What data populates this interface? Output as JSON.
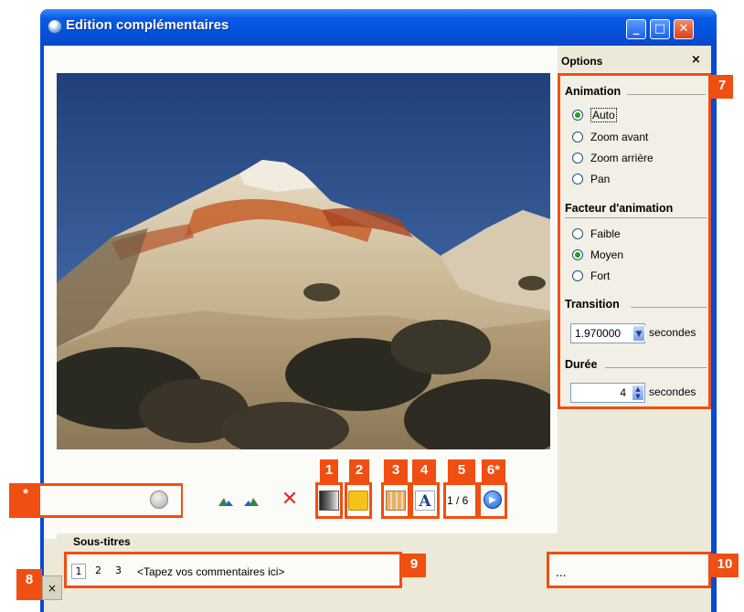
{
  "window": {
    "title": "Edition complémentaires",
    "controls": {
      "minimize": "_",
      "maximize": "□",
      "close": "✕"
    }
  },
  "options": {
    "header": "Options",
    "close_glyph": "×",
    "animation": {
      "title": "Animation",
      "items": [
        "Auto",
        "Zoom avant",
        "Zoom arrière",
        "Pan"
      ],
      "selected": "Auto"
    },
    "facteur": {
      "title": "Facteur d'animation",
      "items": [
        "Faible",
        "Moyen",
        "Fort"
      ],
      "selected": "Moyen"
    },
    "transition": {
      "title": "Transition",
      "value": "1.970000",
      "unit": "secondes"
    },
    "duree": {
      "title": "Durée",
      "value": "4",
      "unit": "secondes"
    }
  },
  "toolbar": {
    "page_counter": "1 / 6",
    "delete_glyph": "✕"
  },
  "subtitles": {
    "label": "Sous-titres",
    "tabs": [
      "1",
      "2",
      "3"
    ],
    "comment_placeholder": "<Tapez vos commentaires ici>",
    "ellipsis": "...",
    "close_glyph": "×"
  },
  "callouts": {
    "c1": "1",
    "c2": "2",
    "c3": "3",
    "c4": "4",
    "c5": "5",
    "c6": "6*",
    "c7": "7",
    "c8": "8",
    "c9": "9",
    "c10": "10",
    "star": "*"
  },
  "colors": {
    "accent": "#ef4f12",
    "titlebar": "#0553db"
  }
}
